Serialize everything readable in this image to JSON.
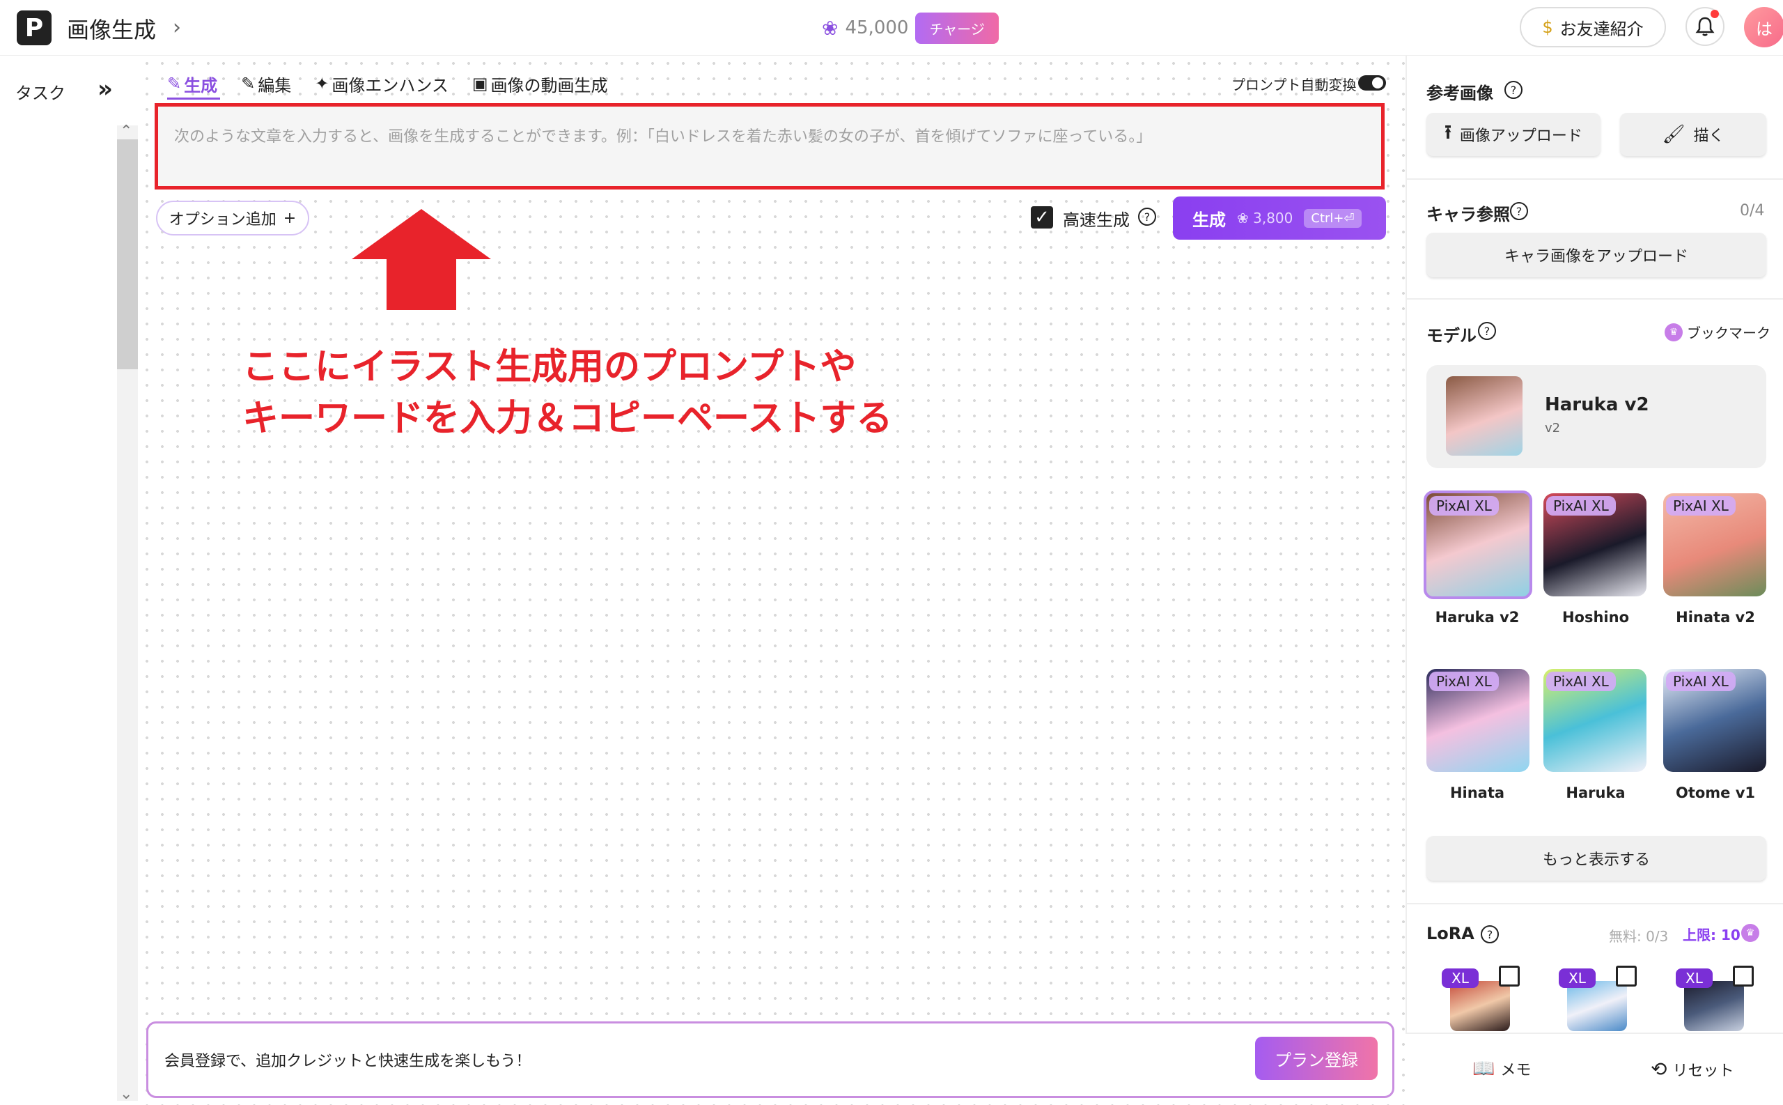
{
  "header": {
    "logo": "P",
    "title": "画像生成",
    "credits": "45,000",
    "charge_label": "チャージ",
    "invite_label": "お友達紹介",
    "avatar_initial": "は"
  },
  "left": {
    "task_label": "タスク"
  },
  "tabs": [
    {
      "label": "生成",
      "icon": "wand-icon",
      "active": true
    },
    {
      "label": "編集",
      "icon": "pen-icon"
    },
    {
      "label": "画像エンハンス",
      "icon": "sparkle-icon"
    },
    {
      "label": "画像の動画生成",
      "icon": "video-icon"
    }
  ],
  "auto_convert_label": "プロンプト自動変換",
  "prompt": {
    "placeholder": "次のような文章を入力すると、画像を生成することができます。例：「白いドレスを着た赤い髪の女の子が、首を傾げてソファに座っている。」"
  },
  "options_label": "オプション追加",
  "fast_gen_label": "高速生成",
  "generate": {
    "label": "生成",
    "cost": "3,800",
    "shortcut": "Ctrl+⏎"
  },
  "annotation": {
    "line1": "ここにイラスト生成用のプロンプトや",
    "line2": "キーワードを入力＆コピーペーストする"
  },
  "promo": {
    "text": "会員登録で、追加クレジットと快速生成を楽しもう！",
    "button": "プラン登録"
  },
  "right": {
    "ref_title": "参考画像",
    "upload_label": "画像アップロード",
    "draw_label": "描く",
    "char_title": "キャラ参照",
    "char_count": "0/4",
    "char_upload": "キャラ画像をアップロード",
    "model_title": "モデル",
    "bookmark": "ブックマーク",
    "current_model": {
      "name": "Haruka v2",
      "version": "v2"
    },
    "models": [
      {
        "badge": "PixAI XL",
        "name": "Haruka v2",
        "selected": true
      },
      {
        "badge": "PixAI XL",
        "name": "Hoshino"
      },
      {
        "badge": "PixAI XL",
        "name": "Hinata v2"
      },
      {
        "badge": "PixAI XL",
        "name": "Hinata"
      },
      {
        "badge": "PixAI XL",
        "name": "Haruka"
      },
      {
        "badge": "PixAI XL",
        "name": "Otome v1"
      }
    ],
    "more_label": "もっと表示する",
    "lora_title": "LoRA",
    "lora_free": "無料: 0/3",
    "lora_limit": "上限: 10",
    "loras": [
      {
        "badge": "XL"
      },
      {
        "badge": "XL"
      },
      {
        "badge": "XL"
      }
    ],
    "memo_label": "メモ",
    "reset_label": "リセット"
  },
  "colors": {
    "accent": "#8a3ff0",
    "annotation_red": "#e8232b"
  }
}
